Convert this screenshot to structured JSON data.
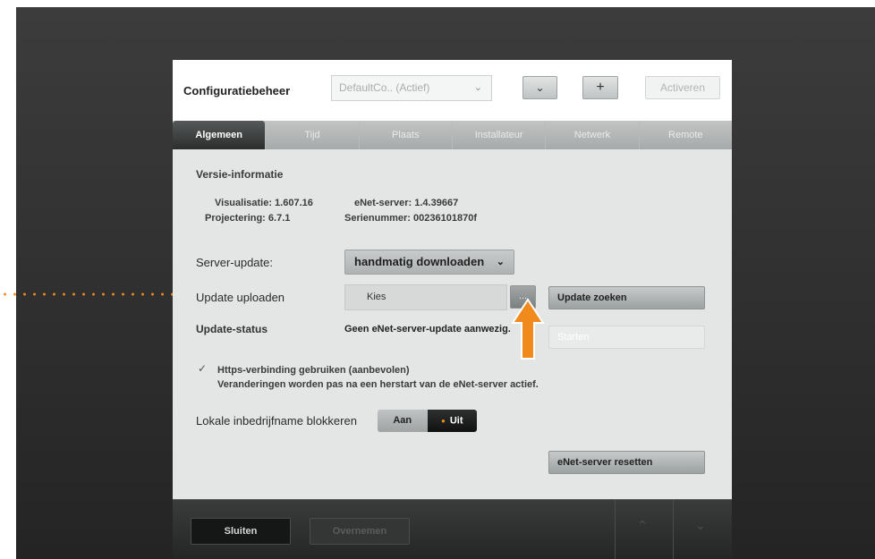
{
  "header": {
    "title": "Configuratiebeheer",
    "config_select_value": "DefaultCo.. (Actief)",
    "activate_label": "Activeren"
  },
  "tabs": [
    {
      "label": "Algemeen",
      "active": true
    },
    {
      "label": "Tijd",
      "active": false
    },
    {
      "label": "Plaats",
      "active": false
    },
    {
      "label": "Installateur",
      "active": false
    },
    {
      "label": "Netwerk",
      "active": false
    },
    {
      "label": "Remote",
      "active": false
    }
  ],
  "version_info": {
    "section_title": "Versie-informatie",
    "visualisatie": "Visualisatie: 1.607.16",
    "projectering": "Projectering: 6.7.1",
    "enet_server": "eNet-server: 1.4.39667",
    "serienummer": "Serienummer: 00236101870f"
  },
  "server_update": {
    "label": "Server-update:",
    "selected": "handmatig downloaden"
  },
  "upload": {
    "label": "Update uploaden",
    "file_value": "Kies",
    "browse_label": "...",
    "search_button": "Update zoeken"
  },
  "status": {
    "label": "Update-status",
    "value": "Geen eNet-server-update aanwezig.",
    "start_button": "Starten"
  },
  "https": {
    "checked": true,
    "label": "Https-verbinding gebruiken (aanbevolen)",
    "note": "Veranderingen worden pas na een herstart van de eNet-server actief."
  },
  "local_block": {
    "label": "Lokale inbedrijfname blokkeren",
    "on_label": "Aan",
    "off_label": "Uit",
    "selected": "Uit"
  },
  "reset_button": "eNet-server resetten",
  "footer": {
    "close_label": "Sluiten",
    "apply_label": "Overnemen"
  },
  "colors": {
    "accent": "#f08a1c",
    "background": "#2f2f2f"
  }
}
